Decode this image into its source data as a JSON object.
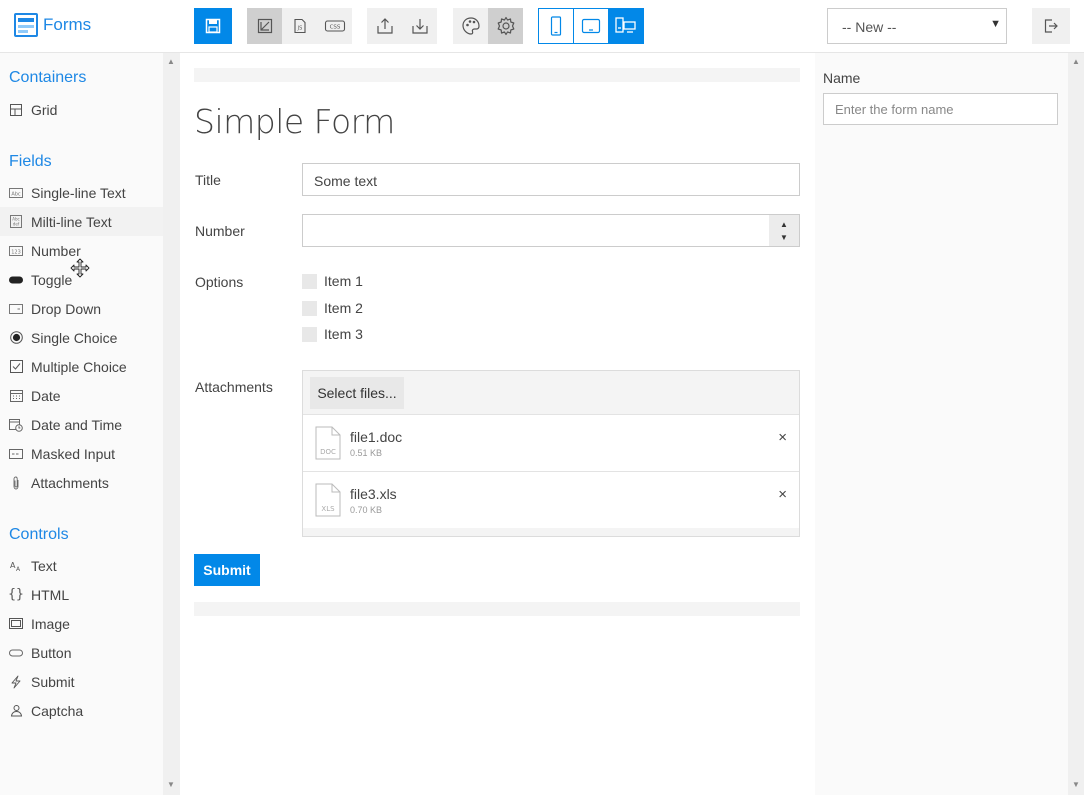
{
  "app": {
    "title": "Forms"
  },
  "toolbar": {
    "new_select": {
      "value": "-- New --"
    },
    "accent": "#0288e8"
  },
  "sidebar": {
    "sections": [
      {
        "heading": "Containers",
        "items": [
          {
            "label": "Grid",
            "icon": "grid-icon"
          }
        ]
      },
      {
        "heading": "Fields",
        "items": [
          {
            "label": "Single-line Text",
            "icon": "single-line-text-icon"
          },
          {
            "label": "Milti-line Text",
            "icon": "multi-line-text-icon"
          },
          {
            "label": "Number",
            "icon": "number-icon"
          },
          {
            "label": "Toggle",
            "icon": "toggle-icon"
          },
          {
            "label": "Drop Down",
            "icon": "dropdown-icon"
          },
          {
            "label": "Single Choice",
            "icon": "radio-icon"
          },
          {
            "label": "Multiple Choice",
            "icon": "checkbox-icon"
          },
          {
            "label": "Date",
            "icon": "calendar-icon"
          },
          {
            "label": "Date and Time",
            "icon": "calendar-clock-icon"
          },
          {
            "label": "Masked Input",
            "icon": "masked-input-icon"
          },
          {
            "label": "Attachments",
            "icon": "paperclip-icon"
          }
        ]
      },
      {
        "heading": "Controls",
        "items": [
          {
            "label": "Text",
            "icon": "text-icon"
          },
          {
            "label": "HTML",
            "icon": "braces-icon"
          },
          {
            "label": "Image",
            "icon": "image-icon"
          },
          {
            "label": "Button",
            "icon": "button-icon"
          },
          {
            "label": "Submit",
            "icon": "lightning-icon"
          },
          {
            "label": "Captcha",
            "icon": "captcha-icon"
          }
        ]
      }
    ]
  },
  "form": {
    "title": "Simple Form",
    "fields": {
      "title": {
        "label": "Title",
        "value": "Some text"
      },
      "number": {
        "label": "Number",
        "value": ""
      },
      "options": {
        "label": "Options",
        "items": [
          "Item 1",
          "Item 2",
          "Item 3"
        ]
      },
      "attachments": {
        "label": "Attachments",
        "select_label": "Select files...",
        "files": [
          {
            "name": "file1.doc",
            "size": "0.51 KB",
            "ext": "DOC"
          },
          {
            "name": "file3.xls",
            "size": "0.70 KB",
            "ext": "XLS"
          }
        ],
        "remove_glyph": "×"
      }
    },
    "submit_label": "Submit"
  },
  "properties": {
    "name_label": "Name",
    "name_placeholder": "Enter the form name"
  }
}
